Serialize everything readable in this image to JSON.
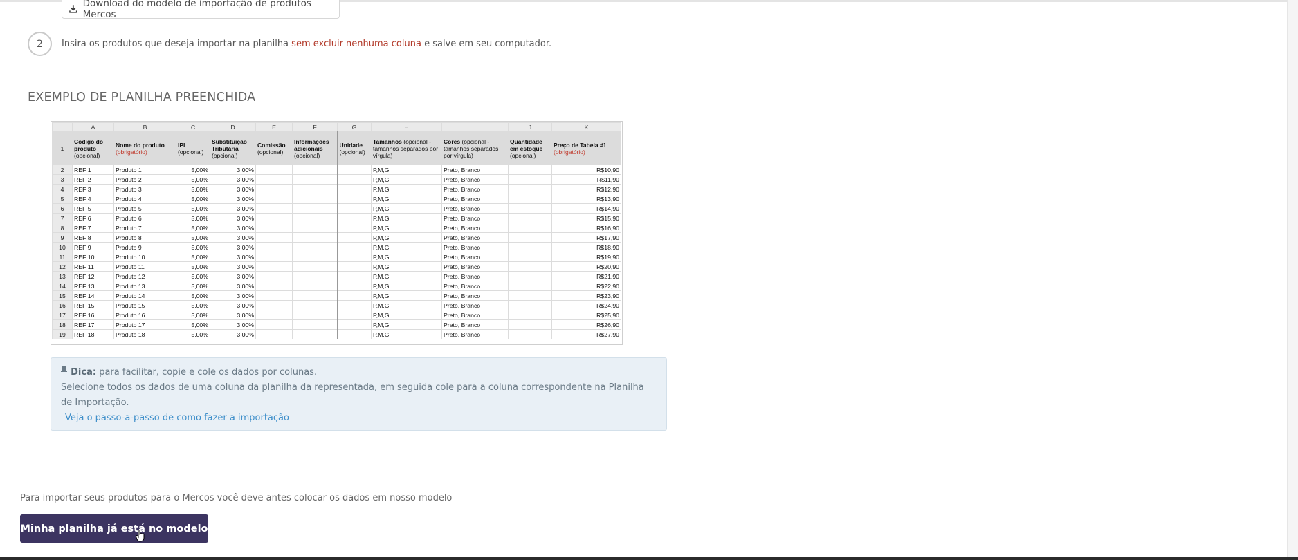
{
  "download_button": {
    "label": "Download do modelo de importação de produtos Mercos",
    "icon": "download-icon"
  },
  "step2": {
    "number": "2",
    "text_before": "Insira os produtos que deseja importar na planilha ",
    "text_warning": "sem excluir nenhuma coluna",
    "text_after": " e salve em seu computador."
  },
  "example": {
    "title": "EXEMPLO DE PLANILHA PREENCHIDA",
    "column_letters": [
      "A",
      "B",
      "C",
      "D",
      "E",
      "F",
      "G",
      "H",
      "I",
      "J",
      "K"
    ],
    "header": [
      {
        "main": "Código do produto",
        "sub": "(opcional)",
        "req": ""
      },
      {
        "main": "Nome do produto",
        "sub": "",
        "req": "(obrigatório)"
      },
      {
        "main": "IPI",
        "sub": "(opcional)",
        "req": ""
      },
      {
        "main": "Substituição Tributária",
        "sub": "(opcional)",
        "req": ""
      },
      {
        "main": "Comissão",
        "sub": "(opcional)",
        "req": ""
      },
      {
        "main": "Informações adicionais",
        "sub": "(opcional)",
        "req": ""
      },
      {
        "main": "Unidade",
        "sub": "(opcional)",
        "req": ""
      },
      {
        "main": "Tamanhos",
        "sub": "(opcional - tamanhos separados por vírgula)",
        "req": ""
      },
      {
        "main": "Cores",
        "sub": "(opcional - tamanhos separados por vírgula)",
        "req": ""
      },
      {
        "main": "Quantidade em estoque",
        "sub": "(opcional)",
        "req": ""
      },
      {
        "main": "Preço de Tabela #1",
        "sub": "",
        "req": "(obrigatório)"
      }
    ],
    "rows": [
      [
        "2",
        "REF 1",
        "Produto 1",
        "5,00%",
        "3,00%",
        "",
        "",
        "",
        "P,M,G",
        "Preto, Branco",
        "",
        "R$10,90"
      ],
      [
        "3",
        "REF 2",
        "Produto 2",
        "5,00%",
        "3,00%",
        "",
        "",
        "",
        "P,M,G",
        "Preto, Branco",
        "",
        "R$11,90"
      ],
      [
        "4",
        "REF 3",
        "Produto 3",
        "5,00%",
        "3,00%",
        "",
        "",
        "",
        "P,M,G",
        "Preto, Branco",
        "",
        "R$12,90"
      ],
      [
        "5",
        "REF 4",
        "Produto 4",
        "5,00%",
        "3,00%",
        "",
        "",
        "",
        "P,M,G",
        "Preto, Branco",
        "",
        "R$13,90"
      ],
      [
        "6",
        "REF 5",
        "Produto 5",
        "5,00%",
        "3,00%",
        "",
        "",
        "",
        "P,M,G",
        "Preto, Branco",
        "",
        "R$14,90"
      ],
      [
        "7",
        "REF 6",
        "Produto 6",
        "5,00%",
        "3,00%",
        "",
        "",
        "",
        "P,M,G",
        "Preto, Branco",
        "",
        "R$15,90"
      ],
      [
        "8",
        "REF 7",
        "Produto 7",
        "5,00%",
        "3,00%",
        "",
        "",
        "",
        "P,M,G",
        "Preto, Branco",
        "",
        "R$16,90"
      ],
      [
        "9",
        "REF 8",
        "Produto 8",
        "5,00%",
        "3,00%",
        "",
        "",
        "",
        "P,M,G",
        "Preto, Branco",
        "",
        "R$17,90"
      ],
      [
        "10",
        "REF 9",
        "Produto 9",
        "5,00%",
        "3,00%",
        "",
        "",
        "",
        "P,M,G",
        "Preto, Branco",
        "",
        "R$18,90"
      ],
      [
        "11",
        "REF 10",
        "Produto 10",
        "5,00%",
        "3,00%",
        "",
        "",
        "",
        "P,M,G",
        "Preto, Branco",
        "",
        "R$19,90"
      ],
      [
        "12",
        "REF 11",
        "Produto 11",
        "5,00%",
        "3,00%",
        "",
        "",
        "",
        "P,M,G",
        "Preto, Branco",
        "",
        "R$20,90"
      ],
      [
        "13",
        "REF 12",
        "Produto 12",
        "5,00%",
        "3,00%",
        "",
        "",
        "",
        "P,M,G",
        "Preto, Branco",
        "",
        "R$21,90"
      ],
      [
        "14",
        "REF 13",
        "Produto 13",
        "5,00%",
        "3,00%",
        "",
        "",
        "",
        "P,M,G",
        "Preto, Branco",
        "",
        "R$22,90"
      ],
      [
        "15",
        "REF 14",
        "Produto 14",
        "5,00%",
        "3,00%",
        "",
        "",
        "",
        "P,M,G",
        "Preto, Branco",
        "",
        "R$23,90"
      ],
      [
        "16",
        "REF 15",
        "Produto 15",
        "5,00%",
        "3,00%",
        "",
        "",
        "",
        "P,M,G",
        "Preto, Branco",
        "",
        "R$24,90"
      ],
      [
        "17",
        "REF 16",
        "Produto 16",
        "5,00%",
        "3,00%",
        "",
        "",
        "",
        "P,M,G",
        "Preto, Branco",
        "",
        "R$25,90"
      ],
      [
        "18",
        "REF 17",
        "Produto 17",
        "5,00%",
        "3,00%",
        "",
        "",
        "",
        "P,M,G",
        "Preto, Branco",
        "",
        "R$26,90"
      ],
      [
        "19",
        "REF 18",
        "Produto 18",
        "5,00%",
        "3,00%",
        "",
        "",
        "",
        "P,M,G",
        "Preto, Branco",
        "",
        "R$27,90"
      ]
    ]
  },
  "tip": {
    "icon": "pin-icon",
    "label": "Dica:",
    "line1": " para facilitar, copie e cole os dados por colunas.",
    "line2": "Selecione todos os dados de uma coluna da planilha da representada, em seguida cole para a coluna correspondente na Planilha de Importação.",
    "link": "Veja o passo-a-passo de como fazer a importação"
  },
  "footer": {
    "text": "Para importar seus produtos para o Mercos você deve antes colocar os dados em nosso modelo",
    "button": "Minha planilha já está no modelo"
  },
  "colors": {
    "primary": "#3c3461",
    "warning": "#b23a2a",
    "link": "#3f8fca",
    "tip_bg": "#e9f0f6"
  }
}
